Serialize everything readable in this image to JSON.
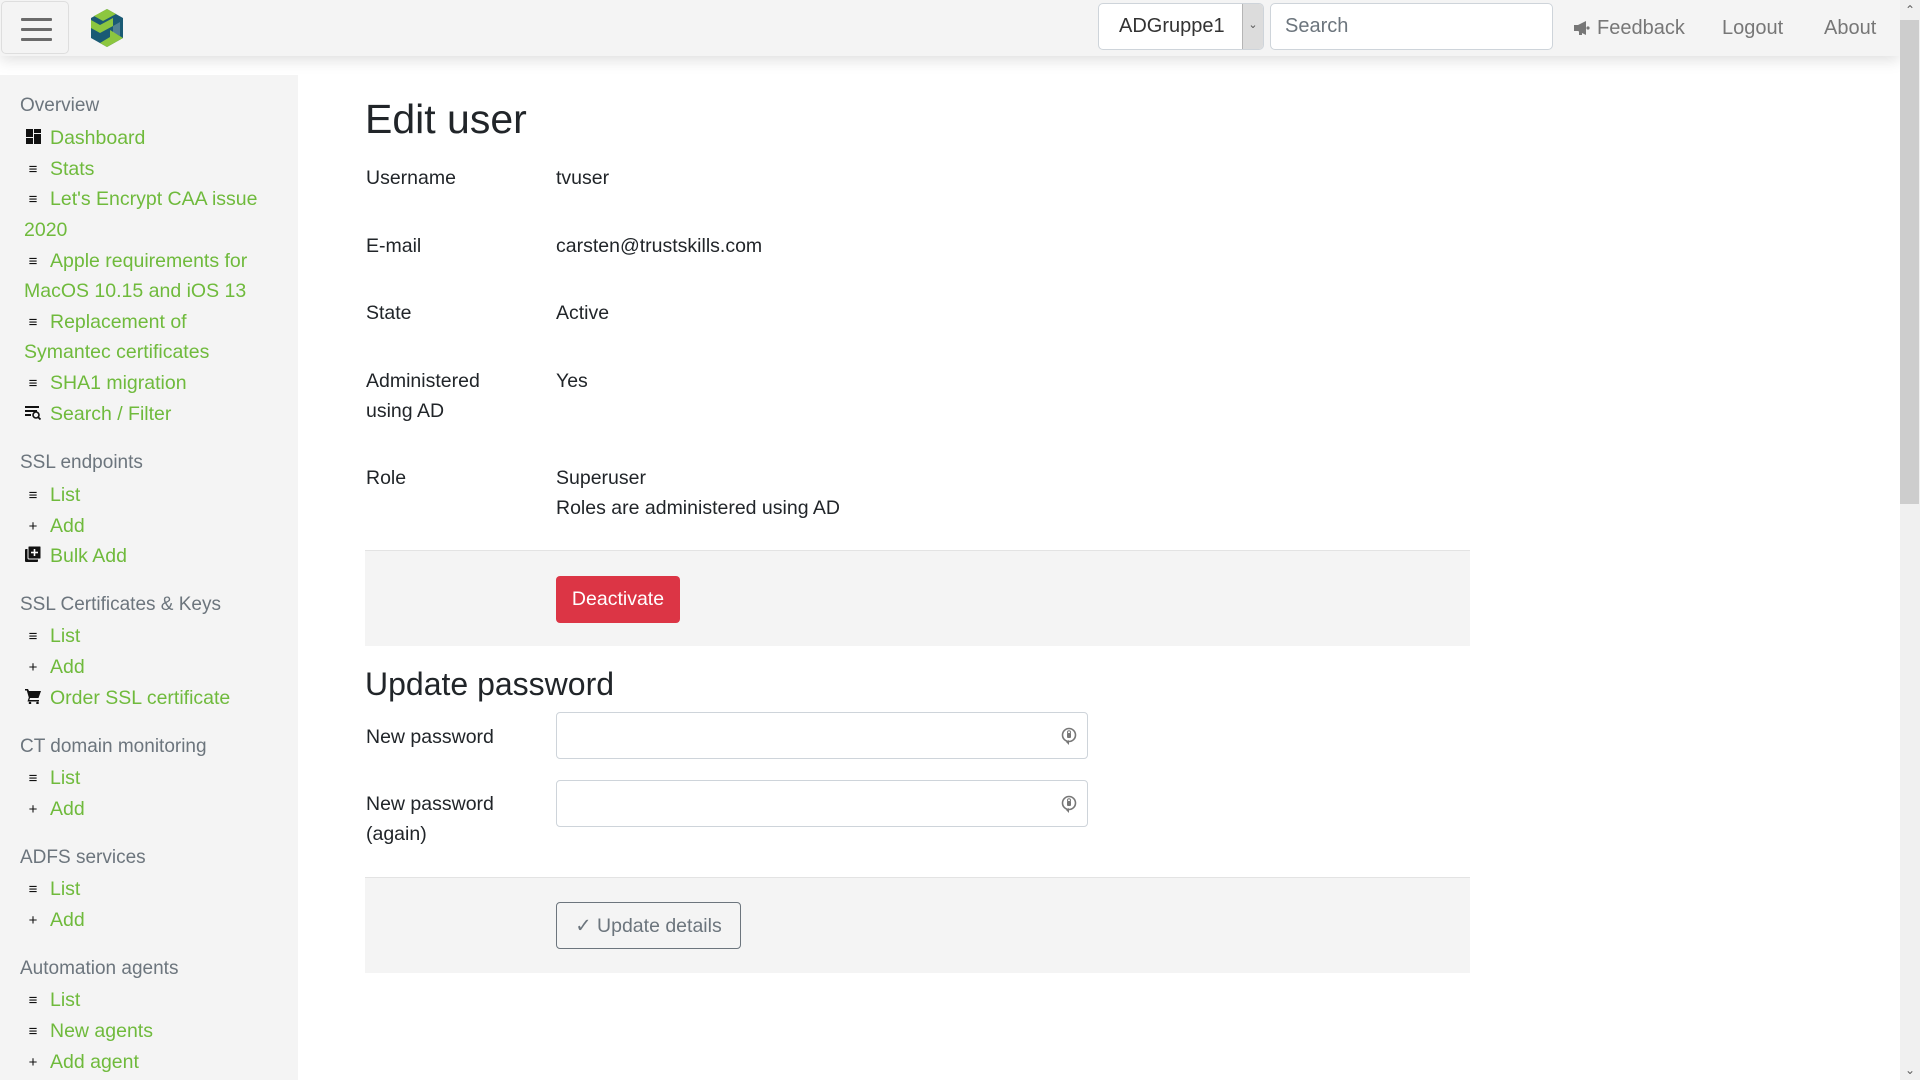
{
  "header": {
    "menu_icon": "hamburger-icon",
    "logo_icon": "app-logo-icon",
    "group_select": {
      "selected": "ADGruppe1"
    },
    "search": {
      "placeholder": "Search",
      "value": ""
    },
    "nav": {
      "feedback": "Feedback",
      "logout": "Logout",
      "about": "About"
    }
  },
  "sidebar": {
    "sections": [
      {
        "title": "Overview",
        "items": [
          {
            "icon": "dashboard-icon",
            "label": "Dashboard"
          },
          {
            "icon": "list-icon",
            "label": "Stats"
          },
          {
            "icon": "list-icon",
            "label": "Let's Encrypt CAA issue",
            "label_cont": "2020"
          },
          {
            "icon": "list-icon",
            "label": "Apple requirements for",
            "label_cont": "MacOS 10.15 and iOS 13"
          },
          {
            "icon": "list-icon",
            "label": "Replacement of",
            "label_cont": "Symantec certificates"
          },
          {
            "icon": "list-icon",
            "label": "SHA1 migration"
          },
          {
            "icon": "search-filter-icon",
            "label": "Search / Filter"
          }
        ]
      },
      {
        "title": "SSL endpoints",
        "items": [
          {
            "icon": "list-icon",
            "label": "List"
          },
          {
            "icon": "plus-icon",
            "label": "Add"
          },
          {
            "icon": "bulk-add-icon",
            "label": "Bulk Add"
          }
        ]
      },
      {
        "title": "SSL Certificates & Keys",
        "items": [
          {
            "icon": "list-icon",
            "label": "List"
          },
          {
            "icon": "plus-icon",
            "label": "Add"
          },
          {
            "icon": "cart-icon",
            "label": "Order SSL certificate"
          }
        ]
      },
      {
        "title": "CT domain monitoring",
        "items": [
          {
            "icon": "list-icon",
            "label": "List"
          },
          {
            "icon": "plus-icon",
            "label": "Add"
          }
        ]
      },
      {
        "title": "ADFS services",
        "items": [
          {
            "icon": "list-icon",
            "label": "List"
          },
          {
            "icon": "plus-icon",
            "label": "Add"
          }
        ]
      },
      {
        "title": "Automation agents",
        "items": [
          {
            "icon": "list-icon",
            "label": "List"
          },
          {
            "icon": "list-icon",
            "label": "New agents"
          },
          {
            "icon": "plus-icon",
            "label": "Add agent"
          }
        ]
      }
    ]
  },
  "main": {
    "title": "Edit user",
    "fields": {
      "username": {
        "label": "Username",
        "value": "tvuser"
      },
      "email": {
        "label": "E-mail",
        "value": "carsten@trustskills.com"
      },
      "state": {
        "label": "State",
        "value": "Active"
      },
      "administered": {
        "label_line1": "Administered",
        "label_line2": "using AD",
        "value": "Yes"
      },
      "role": {
        "label": "Role",
        "value": "Superuser",
        "note": "Roles are administered using AD"
      }
    },
    "deactivate_label": "Deactivate",
    "update_password": {
      "title": "Update password",
      "new_password_label": "New password",
      "new_password_value": "",
      "new_password_again_label_line1": "New password",
      "new_password_again_label_line2": "(again)",
      "new_password_again_value": "",
      "submit_label": "✓ Update details"
    }
  },
  "colors": {
    "link_green": "#6fba3c",
    "danger": "#dc3545",
    "panel_bg": "#f4f4f4",
    "logo_blue": "#1a5a74",
    "logo_green": "#8cc63f"
  }
}
